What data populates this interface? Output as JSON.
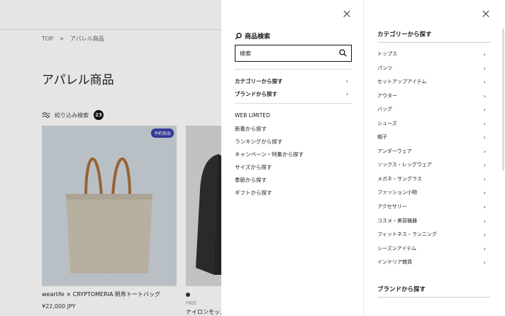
{
  "page": {
    "breadcrumb": [
      "TOP",
      ">",
      "アパレル商品"
    ],
    "title": "アパレル商品",
    "filter": {
      "label": "絞り込み検索",
      "count": "23"
    },
    "products": [
      {
        "badge": "予約商品",
        "name": "wearlife × CRYPTOMERIA 帆布トートバッグ",
        "price": "¥22,000 JPY"
      },
      {
        "free": "FREE",
        "name": "ナイロンモッズ"
      }
    ]
  },
  "menu": {
    "search_heading": "商品検索",
    "search_placeholder": "検索",
    "nav": [
      {
        "label": "カテゴリーから探す"
      },
      {
        "label": "ブランドから探す"
      }
    ],
    "links": [
      "WEB LIMITED",
      "新着から探す",
      "ランキングから探す",
      "キャンペーン・特集から探す",
      "サイズから探す",
      "季節から探す",
      "ギフトから探す"
    ]
  },
  "category_panel": {
    "heading": "カテゴリーから探す",
    "items": [
      "トップス",
      "パンツ",
      "セットアップアイテム",
      "アウター",
      "バッグ",
      "シューズ",
      "帽子",
      "アンダーウェア",
      "ソックス・レッグウェア",
      "メガネ・サングラス",
      "ファッション小物",
      "アクセサリー",
      "コスメ・美容機器",
      "フィットネス・ランニング",
      "シーズンアイテム",
      "インテリア雑貨"
    ],
    "brand_heading": "ブランドから探す"
  },
  "colors": {
    "badge": "#3a3fa8",
    "overlay": "rgba(0,0,0,0.10)"
  }
}
